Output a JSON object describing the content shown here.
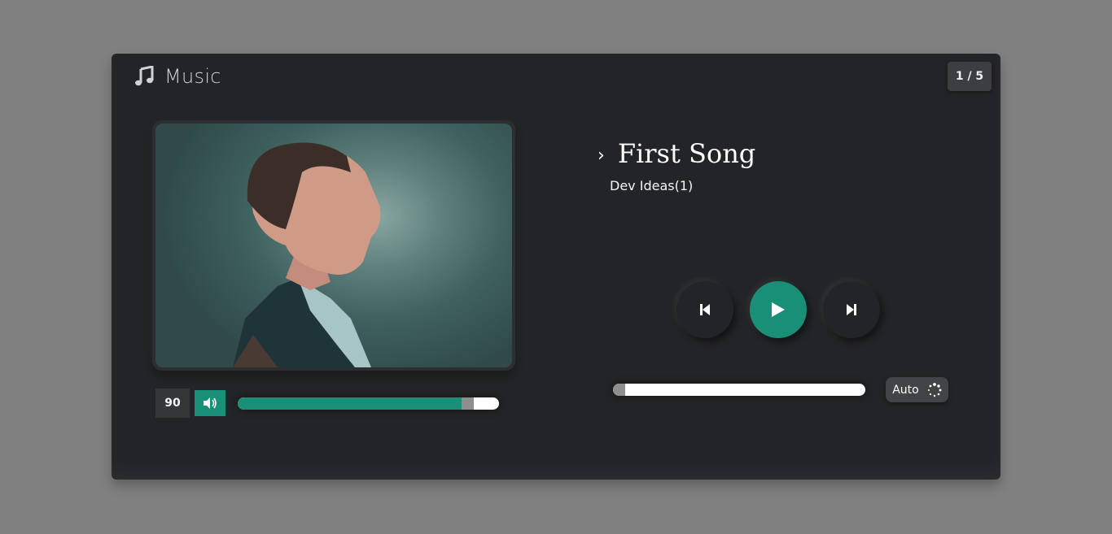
{
  "header": {
    "title": "Music",
    "icon": "music-note-icon"
  },
  "counter": "1 / 5",
  "track": {
    "title": "First Song",
    "artist": "Dev Ideas(1)",
    "chevron": "›",
    "progress_percent": 0
  },
  "volume": {
    "value": "90",
    "level_percent": 90,
    "icon": "speaker-icon"
  },
  "controls": {
    "prev_icon": "skip-previous-icon",
    "play_icon": "play-icon",
    "next_icon": "skip-next-icon"
  },
  "auto_button": {
    "label": "Auto",
    "icon": "loading-spinner-icon"
  },
  "colors": {
    "accent": "#1a8f78",
    "panel": "#232427",
    "backdrop": "#808080"
  }
}
